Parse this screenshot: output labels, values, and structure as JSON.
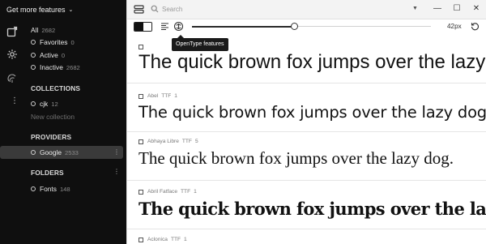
{
  "sidebar": {
    "top_label": "Get more features",
    "filters": [
      {
        "label": "All",
        "count": "2682"
      },
      {
        "label": "Favorites",
        "count": "0"
      },
      {
        "label": "Active",
        "count": "0"
      },
      {
        "label": "Inactive",
        "count": "2682"
      }
    ],
    "collections_title": "COLLECTIONS",
    "collections": [
      {
        "label": "cjk",
        "count": "12"
      }
    ],
    "new_collection": "New collection",
    "providers_title": "PROVIDERS",
    "providers": [
      {
        "label": "Google",
        "count": "2533"
      }
    ],
    "folders_title": "FOLDERS",
    "folders": [
      {
        "label": "Fonts",
        "count": "148"
      }
    ]
  },
  "topbar": {
    "search_placeholder": "Search",
    "minimize": "—",
    "maximize": "☐",
    "close": "✕"
  },
  "toolbar": {
    "size_label": "42px",
    "tooltip": "OpenType features",
    "size_fraction": 0.43
  },
  "fonts": [
    {
      "name": "",
      "type": "",
      "count": "",
      "sample": "The quick brown fox jumps over the lazy dog."
    },
    {
      "name": "Abel",
      "type": "TTF",
      "count": "1",
      "sample": "The quick brown fox jumps over the lazy dog."
    },
    {
      "name": "Abhaya Libre",
      "type": "TTF",
      "count": "5",
      "sample": "The quick brown fox jumps over the lazy dog."
    },
    {
      "name": "Abril Fatface",
      "type": "TTF",
      "count": "1",
      "sample": "The quick brown fox jumps over the lazy dog."
    },
    {
      "name": "Aclonica",
      "type": "TTF",
      "count": "1",
      "sample": ""
    }
  ],
  "colors": {
    "sidebar_bg": "#0f0f0f",
    "selected_row": "#3a3a3a",
    "accent": "#111111"
  }
}
